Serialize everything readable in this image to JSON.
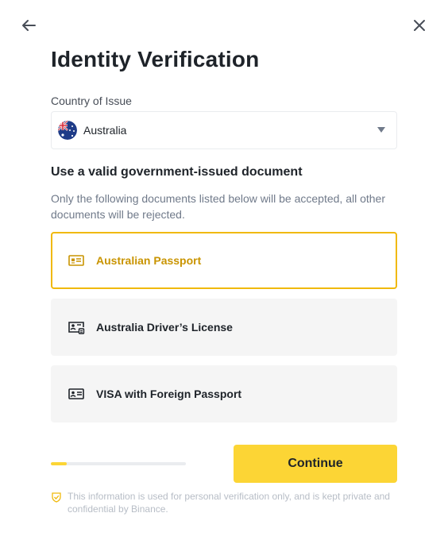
{
  "header": {
    "back_icon": "arrow-left-icon",
    "close_icon": "close-icon",
    "title": "Identity Verification"
  },
  "country": {
    "label": "Country of Issue",
    "selected": "Australia",
    "flag_icon": "australia-flag-icon"
  },
  "documents": {
    "title": "Use a valid government-issued document",
    "description": "Only the following documents listed below will be accepted, all other documents will be rejected.",
    "options": [
      {
        "label": "Australian Passport",
        "icon": "id-card-icon",
        "selected": true
      },
      {
        "label": "Australia Driver’s License",
        "icon": "driver-license-icon",
        "selected": false
      },
      {
        "label": "VISA with Foreign Passport",
        "icon": "visa-card-icon",
        "selected": false
      }
    ]
  },
  "progress": {
    "value": 0.12
  },
  "actions": {
    "continue_label": "Continue"
  },
  "footer": {
    "privacy_icon": "shield-check-icon",
    "privacy_text": "This information is used for personal verification only, and is kept private and confidential by Binance."
  },
  "colors": {
    "accent": "#fcd535",
    "accent_text": "#c99400",
    "selected_border": "#f0b90b",
    "text_primary": "#1e2329",
    "text_secondary": "#707a8a"
  }
}
